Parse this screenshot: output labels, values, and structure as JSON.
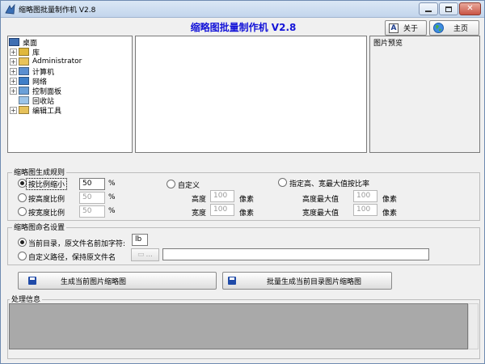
{
  "window": {
    "title": "缩略图批量制作机 V2.8",
    "controls": {
      "minimize_icon": "minimize-icon",
      "maximize_icon": "maximize-icon",
      "close_icon": "close-icon"
    }
  },
  "header": {
    "heading": "缩略图批量制作机  V2.8",
    "about_label": "关于",
    "home_label": "主页",
    "heading_color": "#1414d8"
  },
  "tree": {
    "root": "桌面",
    "items": [
      {
        "label": "库",
        "icon": "library-icon",
        "expandable": true
      },
      {
        "label": "Administrator",
        "icon": "user-folder-icon",
        "expandable": true
      },
      {
        "label": "计算机",
        "icon": "computer-icon",
        "expandable": true
      },
      {
        "label": "网络",
        "icon": "network-icon",
        "expandable": true
      },
      {
        "label": "控制面板",
        "icon": "control-panel-icon",
        "expandable": true
      },
      {
        "label": "回收站",
        "icon": "recycle-bin-icon",
        "expandable": false
      },
      {
        "label": "编辑工具",
        "icon": "folder-icon",
        "expandable": true
      }
    ]
  },
  "preview": {
    "label": "图片预览"
  },
  "rules": {
    "title": "缩略图生成规则",
    "scale": {
      "label": "按比例缩小",
      "value": "50",
      "unit": "%",
      "selected": true
    },
    "by_height": {
      "label": "按高度比例",
      "value": "50",
      "unit": "%"
    },
    "by_width": {
      "label": "按宽度比例",
      "value": "50",
      "unit": "%"
    },
    "custom": {
      "label": "自定义",
      "height_label": "高度",
      "height_value": "100",
      "width_label": "宽度",
      "width_value": "100",
      "unit": "像素"
    },
    "max": {
      "label": "指定高、宽最大值按比率",
      "max_height_label": "高度最大值",
      "max_height_value": "100",
      "max_width_label": "宽度最大值",
      "max_width_value": "100",
      "unit": "像素"
    }
  },
  "naming": {
    "title": "缩略图命名设置",
    "current_dir_label": "当前目录，原文件名前加字符:",
    "prefix_value": "lb",
    "custom_path_label": "自定义路径，保持原文件名",
    "browse_button": "...",
    "path_value": ""
  },
  "actions": {
    "generate_current": "生成当前图片缩略图",
    "batch_generate": "批量生成当前目录图片缩略图"
  },
  "log": {
    "title": "处理信息"
  }
}
